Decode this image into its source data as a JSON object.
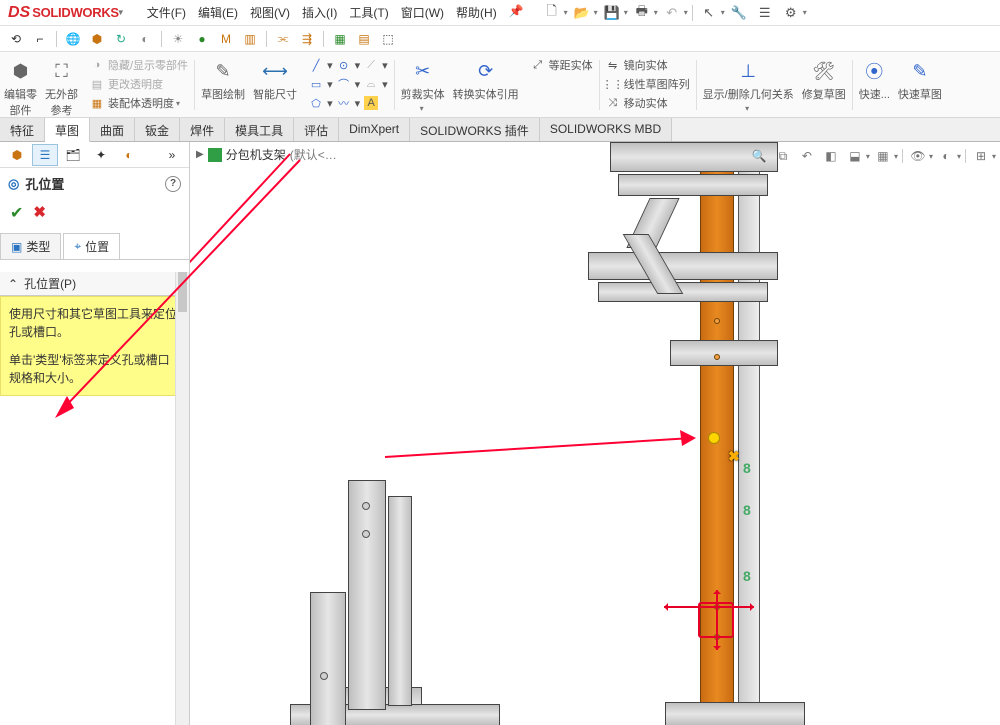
{
  "app": {
    "logo_ds": "DS",
    "logo_text": "SOLIDWORKS"
  },
  "menu": {
    "file": "文件(F)",
    "edit": "编辑(E)",
    "view": "视图(V)",
    "insert": "插入(I)",
    "tools": "工具(T)",
    "window": "窗口(W)",
    "help": "帮助(H)"
  },
  "ribbon": {
    "edit_component": "编辑零\n部件",
    "no_ext_ref": "无外部\n参考",
    "hide_show": "隐藏/显示零部件",
    "change_trans": "更改透明度",
    "assy_trans": "装配体透明度",
    "sketch_paint": "草图绘制",
    "smart_dim": "智能尺寸",
    "crop_body": "剪裁实体",
    "convert_body": "转换实体引用",
    "equidistant": "等距实体",
    "mirror_body": "镜向实体",
    "linear_pattern": "线性草图阵列",
    "move_body": "移动实体",
    "show_hide_rel": "显示/删除几何关系",
    "repair_sketch": "修复草图",
    "quick": "快速...",
    "quick_sketch": "快速草图"
  },
  "tabs": {
    "feature": "特征",
    "sketch": "草图",
    "curve": "曲面",
    "sheetmetal": "钣金",
    "weldment": "焊件",
    "mold": "模具工具",
    "eval": "评估",
    "dimxpert": "DimXpert",
    "plugin": "SOLIDWORKS 插件",
    "mbd": "SOLIDWORKS MBD"
  },
  "breadcrumb": {
    "model": "分包机支架",
    "state": "(默认<…"
  },
  "left": {
    "title": "孔位置",
    "tab_type": "类型",
    "tab_pos": "位置",
    "section": "孔位置(P)",
    "note_p1": "使用尺寸和其它草图工具来定位孔或槽口。",
    "note_p2": "单击'类型'标签来定义孔或槽口规格和大小。"
  }
}
